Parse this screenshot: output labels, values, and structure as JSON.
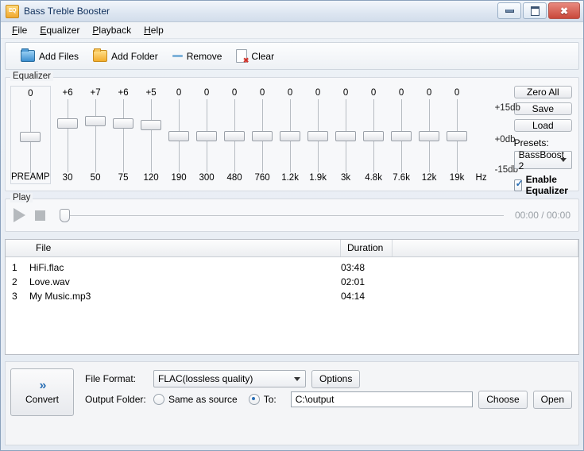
{
  "window": {
    "title": "Bass Treble Booster",
    "icon": "EQ",
    "buttons": {
      "minimize": "minimize-icon",
      "maximize": "maximize-icon",
      "close": "close-icon"
    }
  },
  "menu": [
    {
      "label": "File",
      "accel": "F"
    },
    {
      "label": "Equalizer",
      "accel": "E"
    },
    {
      "label": "Playback",
      "accel": "P"
    },
    {
      "label": "Help",
      "accel": "H"
    }
  ],
  "toolbar": [
    {
      "label": "Add Files",
      "icon": "folder-blue-icon"
    },
    {
      "label": "Add Folder",
      "icon": "folder-yellow-icon"
    },
    {
      "label": "Remove",
      "icon": "minus-icon"
    },
    {
      "label": "Clear",
      "icon": "clear-icon"
    }
  ],
  "equalizer": {
    "group_title": "Equalizer",
    "preamp": {
      "label": "PREAMP",
      "value": "0",
      "db": 0
    },
    "bands": [
      {
        "freq": "30",
        "value": "+6",
        "db": 6
      },
      {
        "freq": "50",
        "value": "+7",
        "db": 7
      },
      {
        "freq": "75",
        "value": "+6",
        "db": 6
      },
      {
        "freq": "120",
        "value": "+5",
        "db": 5
      },
      {
        "freq": "190",
        "value": "0",
        "db": 0
      },
      {
        "freq": "300",
        "value": "0",
        "db": 0
      },
      {
        "freq": "480",
        "value": "0",
        "db": 0
      },
      {
        "freq": "760",
        "value": "0",
        "db": 0
      },
      {
        "freq": "1.2k",
        "value": "0",
        "db": 0
      },
      {
        "freq": "1.9k",
        "value": "0",
        "db": 0
      },
      {
        "freq": "3k",
        "value": "0",
        "db": 0
      },
      {
        "freq": "4.8k",
        "value": "0",
        "db": 0
      },
      {
        "freq": "7.6k",
        "value": "0",
        "db": 0
      },
      {
        "freq": "12k",
        "value": "0",
        "db": 0
      },
      {
        "freq": "19k",
        "value": "0",
        "db": 0
      }
    ],
    "unit": "Hz",
    "scale": {
      "top": "+15db",
      "mid": "+0db",
      "bottom": "-15db"
    },
    "zero_all_label": "Zero All",
    "save_label": "Save",
    "load_label": "Load",
    "presets_label": "Presets:",
    "preset_selected": "BassBoost 2",
    "enable_label": "Enable Equalizer",
    "enable_checked": true
  },
  "play": {
    "group_title": "Play",
    "play_icon": "play-icon",
    "stop_icon": "stop-icon",
    "position": 0,
    "time": "00:00 / 00:00"
  },
  "filelist": {
    "columns": [
      "",
      "File",
      "Duration",
      ""
    ],
    "rows": [
      {
        "index": "1",
        "file": "HiFi.flac",
        "duration": "03:48"
      },
      {
        "index": "2",
        "file": "Love.wav",
        "duration": "02:01"
      },
      {
        "index": "3",
        "file": "My Music.mp3",
        "duration": "04:14"
      }
    ]
  },
  "convert_panel": {
    "convert_label": "Convert",
    "convert_icon": "double-chevron-right-icon",
    "file_format_label": "File Format:",
    "file_format_value": "FLAC(lossless quality)",
    "options_label": "Options",
    "output_folder_label": "Output Folder:",
    "same_as_source_label": "Same as source",
    "same_as_source_selected": false,
    "to_label": "To:",
    "to_selected": true,
    "output_path": "C:\\output",
    "choose_label": "Choose",
    "open_label": "Open"
  },
  "colors": {
    "accent": "#2a6fb5",
    "close": "#c9483a",
    "title_text": "#10305c"
  }
}
